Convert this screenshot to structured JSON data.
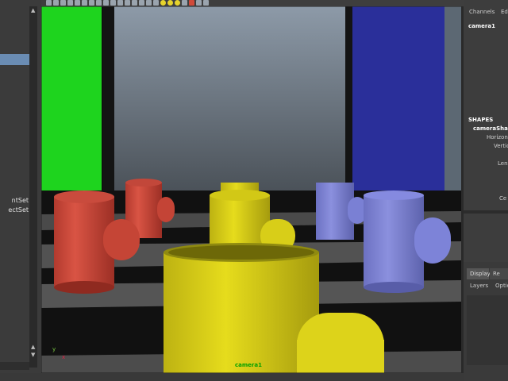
{
  "outliner": {
    "items": [
      "ntSet",
      "ectSet"
    ]
  },
  "viewport": {
    "camera_label": "camera1",
    "axis_y": "y",
    "axis_x": "x"
  },
  "channel_box": {
    "tab_channels": "Channels",
    "tab_edit": "Ed",
    "object_name": "camera1",
    "shapes_header": "SHAPES",
    "shape_name": "cameraSha",
    "attributes": [
      "Horizont",
      "Vertic",
      "Lens",
      "Ce"
    ],
    "layer_tabs": [
      "Display",
      "Re"
    ],
    "layer_menu": [
      "Layers",
      "Optio"
    ]
  },
  "colors": {
    "green_wall": "#1ed41e",
    "blue_wall": "#2a2f9a",
    "red_pipe": "#d24a3c",
    "yellow_pipe": "#e2d81a",
    "purple_pipe": "#7e84d6",
    "camera_label": "#00a000"
  }
}
